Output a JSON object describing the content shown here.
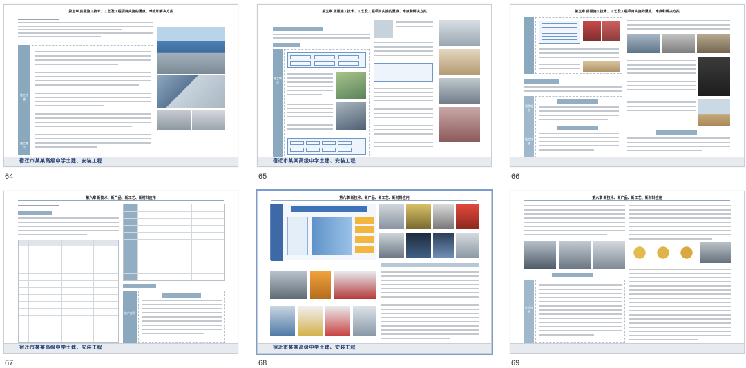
{
  "pages": [
    {
      "number": "64",
      "header": "第五章 房屋施工技术、工艺及工程项目实施的重点、难点和解决方案",
      "footer": "宿迁市某某高级中学土建、安装工程",
      "side_labels": [
        "施工进度",
        "施工难点"
      ]
    },
    {
      "number": "65",
      "header": "第五章 房屋施工技术、工艺及工程项目实施的重点、难点和解决方案",
      "footer": "宿迁市某某高级中学土建、安装工程",
      "side_labels": [
        "施工特点"
      ]
    },
    {
      "number": "66",
      "header": "第五章 房屋施工技术、工艺及工程项目实施的重点、难点和解决方案",
      "footer": "",
      "side_labels": [
        "雨季施工",
        "施工措施"
      ]
    },
    {
      "number": "67",
      "header": "第六章 新技术、新产品、新工艺、新材料应用",
      "footer": "宿迁市某某高级中学土建、安装工程",
      "side_labels": [
        "推广应用"
      ]
    },
    {
      "number": "68",
      "header": "第六章 新技术、新产品、新工艺、新材料应用",
      "footer": "宿迁市某某高级中学土建、安装工程",
      "side_labels": []
    },
    {
      "number": "69",
      "header": "第六章 新技术、新产品、新工艺、新材料应用",
      "footer": "",
      "side_labels": [
        "应用技术"
      ]
    }
  ]
}
